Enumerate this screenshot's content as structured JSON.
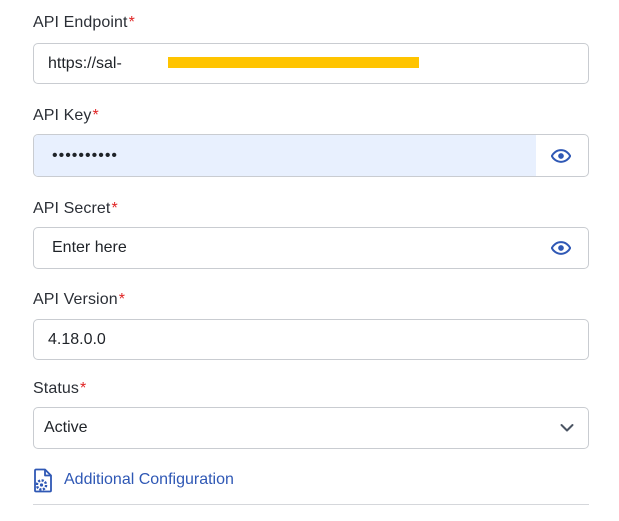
{
  "form": {
    "endpoint": {
      "label": "API Endpoint",
      "required": "*",
      "value": "https://sal-"
    },
    "api_key": {
      "label": "API Key",
      "required": "*",
      "value": "••••••••••"
    },
    "api_secret": {
      "label": "API Secret",
      "required": "*",
      "placeholder": "Enter here"
    },
    "api_version": {
      "label": "API Version",
      "required": "*",
      "value": "4.18.0.0"
    },
    "status": {
      "label": "Status",
      "required": "*",
      "value": "Active"
    }
  },
  "additional": {
    "label": "Additional Configuration"
  },
  "icons": {
    "eye": "eye-icon",
    "chevron": "chevron-down-icon",
    "config_file": "file-settings-icon"
  },
  "colors": {
    "required": "#e02424",
    "accent": "#2f58b5",
    "autofill": "#e8f0fe",
    "redaction": "#ffc400"
  }
}
